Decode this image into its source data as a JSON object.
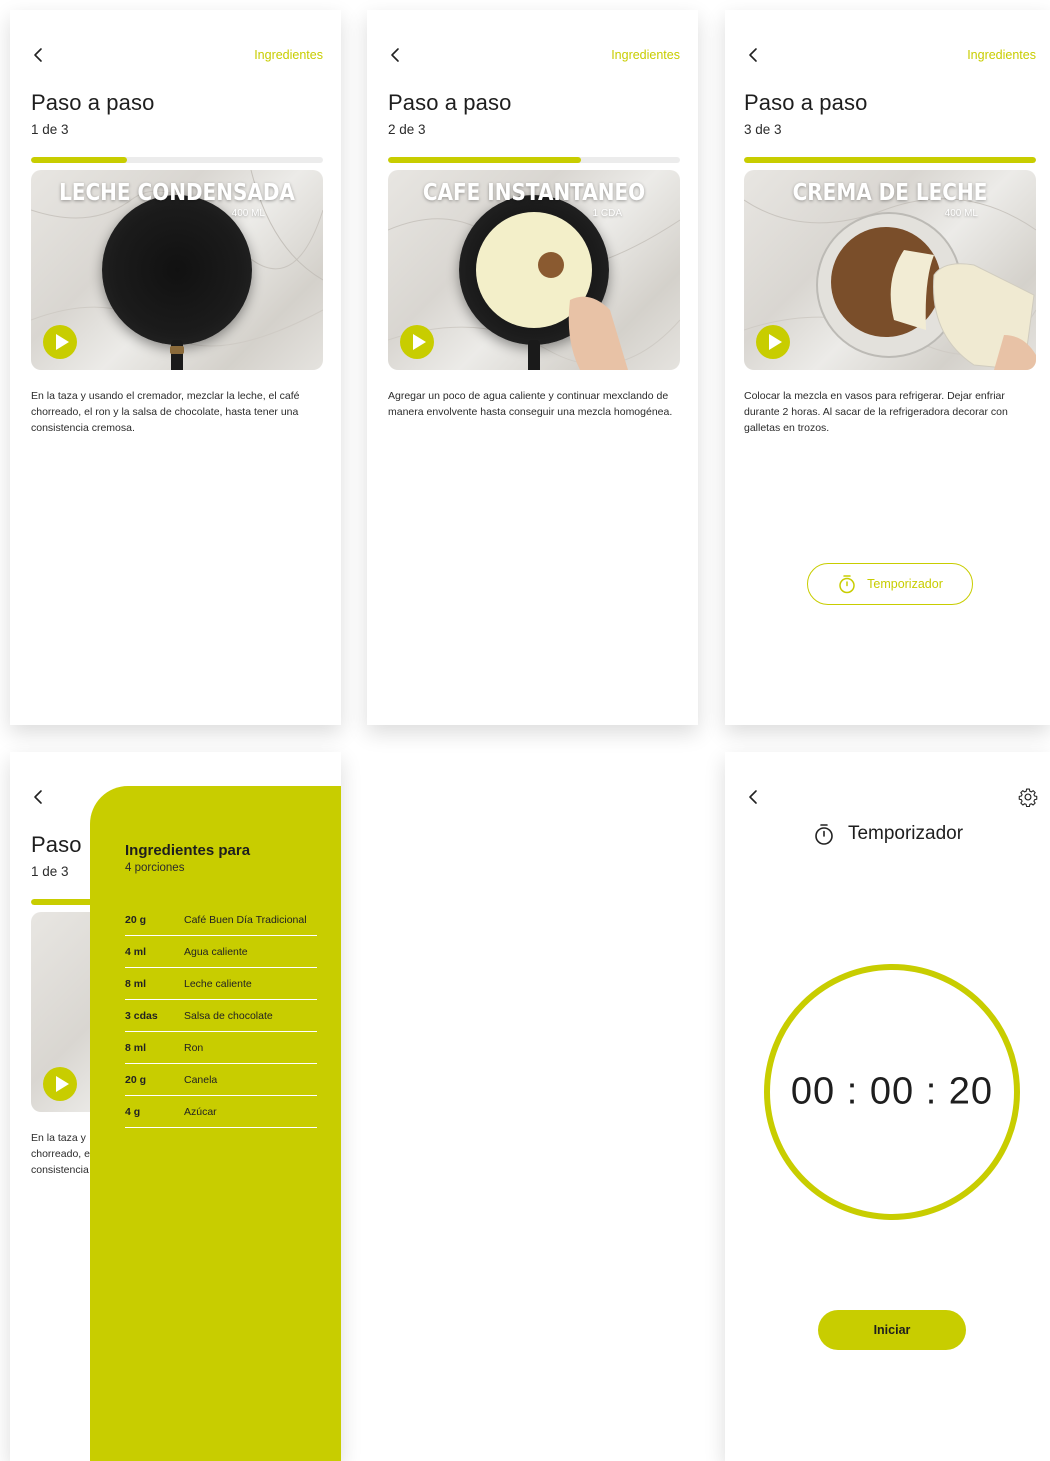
{
  "accent_color": "#c8cd00",
  "screens": [
    {
      "ingredients_link": "Ingredientes",
      "title": "Paso a paso",
      "counter": "1 de 3",
      "progress": 0.33,
      "video_title": "LECHE CONDENSADA",
      "video_sub": "400 ML",
      "description": "En la taza y usando el cremador, mezclar la leche, el café chorreado, el ron y la salsa de chocolate, hasta tener una consistencia cremosa."
    },
    {
      "ingredients_link": "Ingredientes",
      "title": "Paso a paso",
      "counter": "2 de 3",
      "progress": 0.66,
      "video_title": "CAFE INSTANTANEO",
      "video_sub": "1 CDA",
      "description": "Agregar un poco de agua caliente y continuar mexclando de manera envolvente hasta conseguir una mezcla homogénea."
    },
    {
      "ingredients_link": "Ingredientes",
      "title": "Paso a paso",
      "counter": "3 de 3",
      "progress": 1.0,
      "video_title": "CREMA DE LECHE",
      "video_sub": "400 ML",
      "description": "Colocar la mezcla en vasos para refrigerar. Dejar enfriar durante 2 horas. Al sacar de la refrigeradora decorar con galletas en trozos.",
      "timer_button": "Temporizador"
    }
  ],
  "ingredients_screen": {
    "title_partial": "Paso",
    "counter": "1 de 3",
    "desc_lines": [
      "En la taza y",
      "chorreado, e",
      "consistencia"
    ],
    "panel_title": "Ingredientes para",
    "panel_sub": "4 porciones",
    "items": [
      {
        "qty": "20 g",
        "name": "Café Buen Día Tradicional"
      },
      {
        "qty": "4 ml",
        "name": "Agua caliente"
      },
      {
        "qty": "8 ml",
        "name": "Leche caliente"
      },
      {
        "qty": "3 cdas",
        "name": "Salsa de chocolate"
      },
      {
        "qty": "8 ml",
        "name": "Ron"
      },
      {
        "qty": "20 g",
        "name": "Canela"
      },
      {
        "qty": "4 g",
        "name": "Azúcar"
      }
    ]
  },
  "timer_screen": {
    "title": "Temporizador",
    "time": "00 : 00 : 20",
    "start_button": "Iniciar"
  }
}
